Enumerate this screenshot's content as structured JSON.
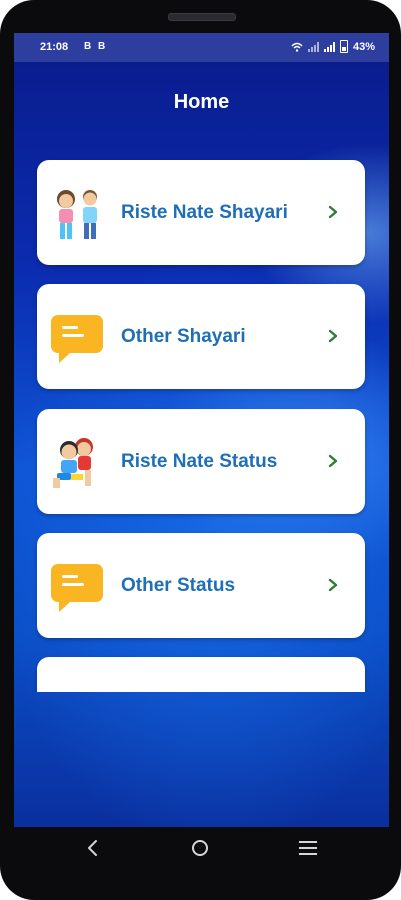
{
  "status_bar": {
    "time": "21:08",
    "indicators": [
      "B",
      "B"
    ],
    "battery": "43%"
  },
  "header": {
    "title": "Home"
  },
  "menu": {
    "items": [
      {
        "label": "Riste Nate Shayari",
        "icon": "couple-kids-icon"
      },
      {
        "label": "Other Shayari",
        "icon": "chat-bubble-icon"
      },
      {
        "label": "Riste Nate Status",
        "icon": "hugging-kids-icon"
      },
      {
        "label": "Other Status",
        "icon": "chat-bubble-icon"
      },
      {
        "label": "",
        "icon": "partial-round-icon"
      }
    ]
  },
  "colors": {
    "label": "#1f6fb5",
    "chevron": "#2e7d32",
    "bubble": "#f9b522",
    "statusbar": "#2e3e9f"
  },
  "nav_bar": {
    "buttons": [
      "back",
      "home",
      "recents"
    ]
  }
}
